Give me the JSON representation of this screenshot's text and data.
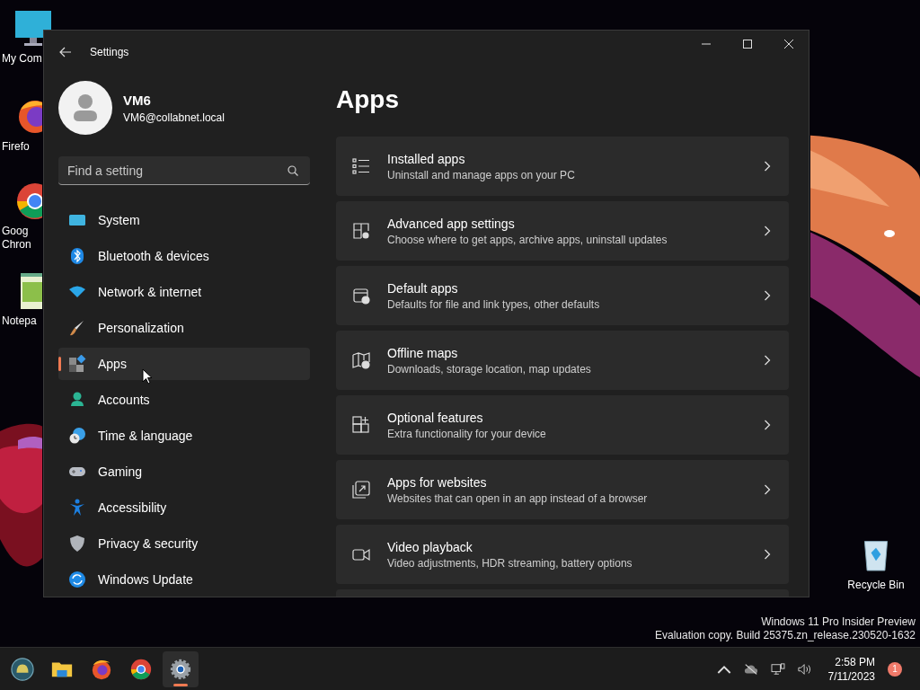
{
  "desktop": {
    "icons": [
      {
        "kind": "computer",
        "lines": [
          "My Com"
        ]
      },
      {
        "kind": "firefox",
        "lines": [
          "Firefo"
        ]
      },
      {
        "kind": "chrome",
        "lines": [
          "Goog",
          "Chron"
        ]
      },
      {
        "kind": "notepad",
        "lines": [
          "Notepa"
        ]
      }
    ],
    "recycle_bin": {
      "label": "Recycle Bin"
    },
    "system_notice": [
      "Windows 11 Pro Insider Preview",
      "Evaluation copy. Build 25375.zn_release.230520-1632"
    ]
  },
  "window": {
    "title": "Settings",
    "user": {
      "name": "VM6",
      "email": "VM6@collabnet.local"
    },
    "search": {
      "placeholder": "Find a setting"
    },
    "nav": [
      {
        "label": "System",
        "kind": "system",
        "selected": false
      },
      {
        "label": "Bluetooth & devices",
        "kind": "bluetooth",
        "selected": false
      },
      {
        "label": "Network & internet",
        "kind": "network",
        "selected": false
      },
      {
        "label": "Personalization",
        "kind": "brush",
        "selected": false
      },
      {
        "label": "Apps",
        "kind": "apps",
        "selected": true
      },
      {
        "label": "Accounts",
        "kind": "accounts",
        "selected": false
      },
      {
        "label": "Time & language",
        "kind": "time",
        "selected": false
      },
      {
        "label": "Gaming",
        "kind": "gaming",
        "selected": false
      },
      {
        "label": "Accessibility",
        "kind": "accessibility",
        "selected": false
      },
      {
        "label": "Privacy & security",
        "kind": "shield",
        "selected": false
      },
      {
        "label": "Windows Update",
        "kind": "update",
        "selected": false
      }
    ],
    "page_title": "Apps",
    "cards": [
      {
        "title": "Installed apps",
        "subtitle": "Uninstall and manage apps on your PC",
        "kind": "list"
      },
      {
        "title": "Advanced app settings",
        "subtitle": "Choose where to get apps, archive apps, uninstall updates",
        "kind": "gear"
      },
      {
        "title": "Default apps",
        "subtitle": "Defaults for file and link types, other defaults",
        "kind": "check"
      },
      {
        "title": "Offline maps",
        "subtitle": "Downloads, storage location, map updates",
        "kind": "map"
      },
      {
        "title": "Optional features",
        "subtitle": "Extra functionality for your device",
        "kind": "plus"
      },
      {
        "title": "Apps for websites",
        "subtitle": "Websites that can open in an app instead of a browser",
        "kind": "link"
      },
      {
        "title": "Video playback",
        "subtitle": "Video adjustments, HDR streaming, battery options",
        "kind": "video"
      }
    ]
  },
  "taskbar": {
    "apps": [
      {
        "kind": "start",
        "selected": false
      },
      {
        "kind": "folder",
        "selected": false
      },
      {
        "kind": "firefox",
        "selected": false
      },
      {
        "kind": "chrome",
        "selected": false
      },
      {
        "kind": "settings",
        "selected": true
      }
    ],
    "tray": {
      "time": "2:58 PM",
      "date": "7/11/2023",
      "notification_count": "1"
    }
  }
}
